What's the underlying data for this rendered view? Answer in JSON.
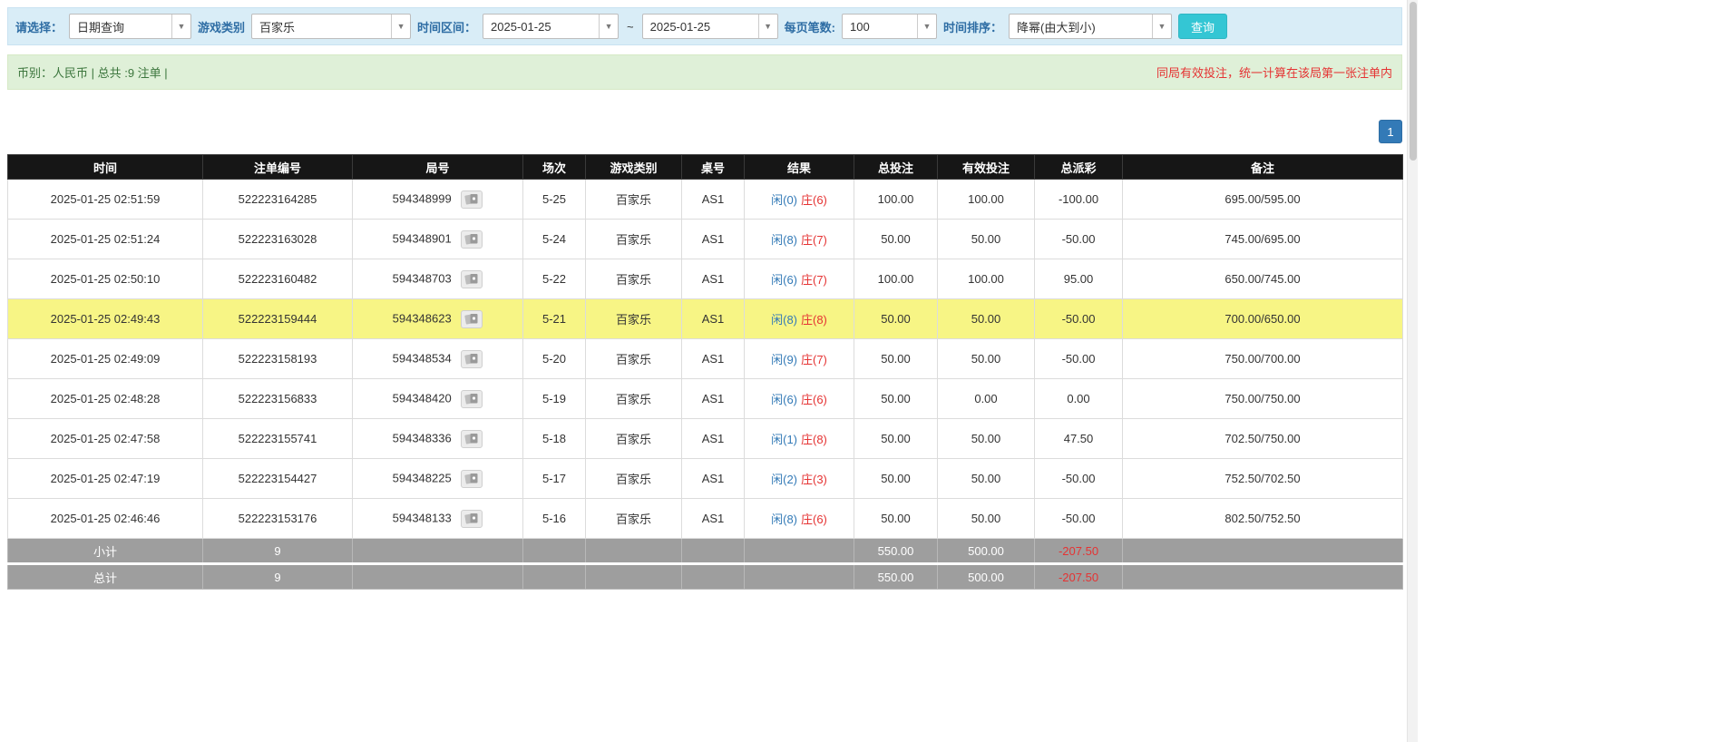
{
  "colors": {
    "accent_blue": "#337ab7",
    "player_blue": "#337ab7",
    "banker_red": "#e53333",
    "negative_red": "#e53333",
    "highlight_yellow": "#f7f585",
    "query_button_cyan": "#34c6d4",
    "filter_bar_bg": "#d9edf7",
    "info_bar_bg": "#dff0d8",
    "table_header_bg": "#161616",
    "table_footer_bg": "#9e9e9e"
  },
  "filter_bar": {
    "select_label": "请选择：",
    "select_value": "日期查询",
    "game_type_label": "游戏类别",
    "game_type_value": "百家乐",
    "time_range_label": "时间区间：",
    "date_from": "2025-01-25",
    "tilde": "~",
    "date_to": "2025-01-25",
    "page_size_label": "每页笔数:",
    "page_size_value": "100",
    "sort_label": "时间排序：",
    "sort_value": "降幂(由大到小)",
    "query_button": "查询",
    "dropdown_arrow": "▼"
  },
  "info_bar": {
    "summary": "币别：人民币 | 总共 :9 注单 |",
    "notice": "同局有效投注，统一计算在该局第一张注单内"
  },
  "pagination": {
    "page": "1"
  },
  "table": {
    "headers": [
      "时间",
      "注单编号",
      "局号",
      "场次",
      "游戏类别",
      "桌号",
      "结果",
      "总投注",
      "有效投注",
      "总派彩",
      "备注"
    ],
    "rows": [
      {
        "time": "2025-01-25 02:51:59",
        "bet_id": "522223164285",
        "round_id": "594348999",
        "session": "5-25",
        "game": "百家乐",
        "table_no": "AS1",
        "result_player": "闲(0)",
        "result_banker": "庄(6)",
        "total_bet": "100.00",
        "valid_bet": "100.00",
        "payout": "-100.00",
        "remark": "695.00/595.00",
        "highlight": false
      },
      {
        "time": "2025-01-25 02:51:24",
        "bet_id": "522223163028",
        "round_id": "594348901",
        "session": "5-24",
        "game": "百家乐",
        "table_no": "AS1",
        "result_player": "闲(8)",
        "result_banker": "庄(7)",
        "total_bet": "50.00",
        "valid_bet": "50.00",
        "payout": "-50.00",
        "remark": "745.00/695.00",
        "highlight": false
      },
      {
        "time": "2025-01-25 02:50:10",
        "bet_id": "522223160482",
        "round_id": "594348703",
        "session": "5-22",
        "game": "百家乐",
        "table_no": "AS1",
        "result_player": "闲(6)",
        "result_banker": "庄(7)",
        "total_bet": "100.00",
        "valid_bet": "100.00",
        "payout": "95.00",
        "remark": "650.00/745.00",
        "highlight": false
      },
      {
        "time": "2025-01-25 02:49:43",
        "bet_id": "522223159444",
        "round_id": "594348623",
        "session": "5-21",
        "game": "百家乐",
        "table_no": "AS1",
        "result_player": "闲(8)",
        "result_banker": "庄(8)",
        "total_bet": "50.00",
        "valid_bet": "50.00",
        "payout": "-50.00",
        "remark": "700.00/650.00",
        "highlight": true
      },
      {
        "time": "2025-01-25 02:49:09",
        "bet_id": "522223158193",
        "round_id": "594348534",
        "session": "5-20",
        "game": "百家乐",
        "table_no": "AS1",
        "result_player": "闲(9)",
        "result_banker": "庄(7)",
        "total_bet": "50.00",
        "valid_bet": "50.00",
        "payout": "-50.00",
        "remark": "750.00/700.00",
        "highlight": false
      },
      {
        "time": "2025-01-25 02:48:28",
        "bet_id": "522223156833",
        "round_id": "594348420",
        "session": "5-19",
        "game": "百家乐",
        "table_no": "AS1",
        "result_player": "闲(6)",
        "result_banker": "庄(6)",
        "total_bet": "50.00",
        "valid_bet": "0.00",
        "payout": "0.00",
        "remark": "750.00/750.00",
        "highlight": false
      },
      {
        "time": "2025-01-25 02:47:58",
        "bet_id": "522223155741",
        "round_id": "594348336",
        "session": "5-18",
        "game": "百家乐",
        "table_no": "AS1",
        "result_player": "闲(1)",
        "result_banker": "庄(8)",
        "total_bet": "50.00",
        "valid_bet": "50.00",
        "payout": "47.50",
        "remark": "702.50/750.00",
        "highlight": false
      },
      {
        "time": "2025-01-25 02:47:19",
        "bet_id": "522223154427",
        "round_id": "594348225",
        "session": "5-17",
        "game": "百家乐",
        "table_no": "AS1",
        "result_player": "闲(2)",
        "result_banker": "庄(3)",
        "total_bet": "50.00",
        "valid_bet": "50.00",
        "payout": "-50.00",
        "remark": "752.50/702.50",
        "highlight": false
      },
      {
        "time": "2025-01-25 02:46:46",
        "bet_id": "522223153176",
        "round_id": "594348133",
        "session": "5-16",
        "game": "百家乐",
        "table_no": "AS1",
        "result_player": "闲(8)",
        "result_banker": "庄(6)",
        "total_bet": "50.00",
        "valid_bet": "50.00",
        "payout": "-50.00",
        "remark": "802.50/752.50",
        "highlight": false
      }
    ],
    "subtotal": {
      "label": "小计",
      "count": "9",
      "total_bet": "550.00",
      "valid_bet": "500.00",
      "payout": "-207.50"
    },
    "total": {
      "label": "总计",
      "count": "9",
      "total_bet": "550.00",
      "valid_bet": "500.00",
      "payout": "-207.50"
    }
  }
}
